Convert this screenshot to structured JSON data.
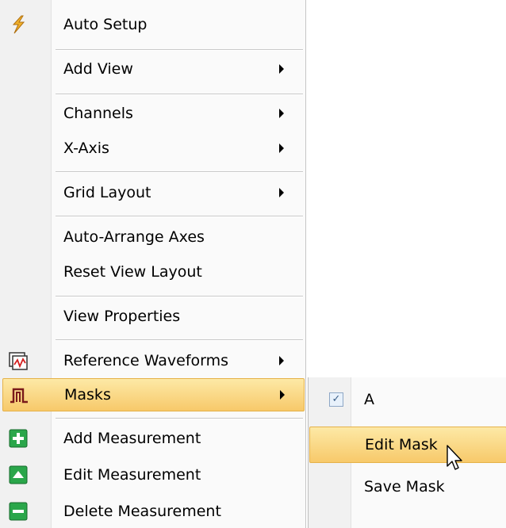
{
  "menu": {
    "items": [
      {
        "key": "auto_setup",
        "label": "Auto Setup",
        "has_submenu": false,
        "icon": "lightning-bolt-icon"
      },
      {
        "key": "add_view",
        "label": "Add View",
        "has_submenu": true
      },
      {
        "key": "channels",
        "label": "Channels",
        "has_submenu": true
      },
      {
        "key": "x_axis",
        "label": "X-Axis",
        "has_submenu": true
      },
      {
        "key": "grid_layout",
        "label": "Grid Layout",
        "has_submenu": true
      },
      {
        "key": "auto_arrange",
        "label": "Auto-Arrange Axes",
        "has_submenu": false
      },
      {
        "key": "reset_view",
        "label": "Reset View Layout",
        "has_submenu": false
      },
      {
        "key": "view_properties",
        "label": "View Properties",
        "has_submenu": false
      },
      {
        "key": "reference_waveforms",
        "label": "Reference Waveforms",
        "has_submenu": true,
        "icon": "reference-waveform-icon"
      },
      {
        "key": "masks",
        "label": "Masks",
        "has_submenu": true,
        "icon": "mask-pulse-icon",
        "highlighted": true
      },
      {
        "key": "add_measurement",
        "label": "Add Measurement",
        "has_submenu": false,
        "icon": "plus-icon"
      },
      {
        "key": "edit_measurement",
        "label": "Edit Measurement",
        "has_submenu": false,
        "icon": "up-triangle-icon"
      },
      {
        "key": "delete_measurement",
        "label": "Delete Measurement",
        "has_submenu": false,
        "icon": "minus-icon"
      }
    ]
  },
  "submenu": {
    "items": [
      {
        "key": "mask_a",
        "label": "A",
        "checked": true
      },
      {
        "key": "edit_mask",
        "label": "Edit Mask",
        "highlighted": true
      },
      {
        "key": "save_mask",
        "label": "Save Mask"
      }
    ]
  },
  "colors": {
    "highlight_top": "#fde9a6",
    "highlight_bottom": "#f7c96a",
    "icon_green": "#2aa64a",
    "icon_red": "#d42020"
  }
}
